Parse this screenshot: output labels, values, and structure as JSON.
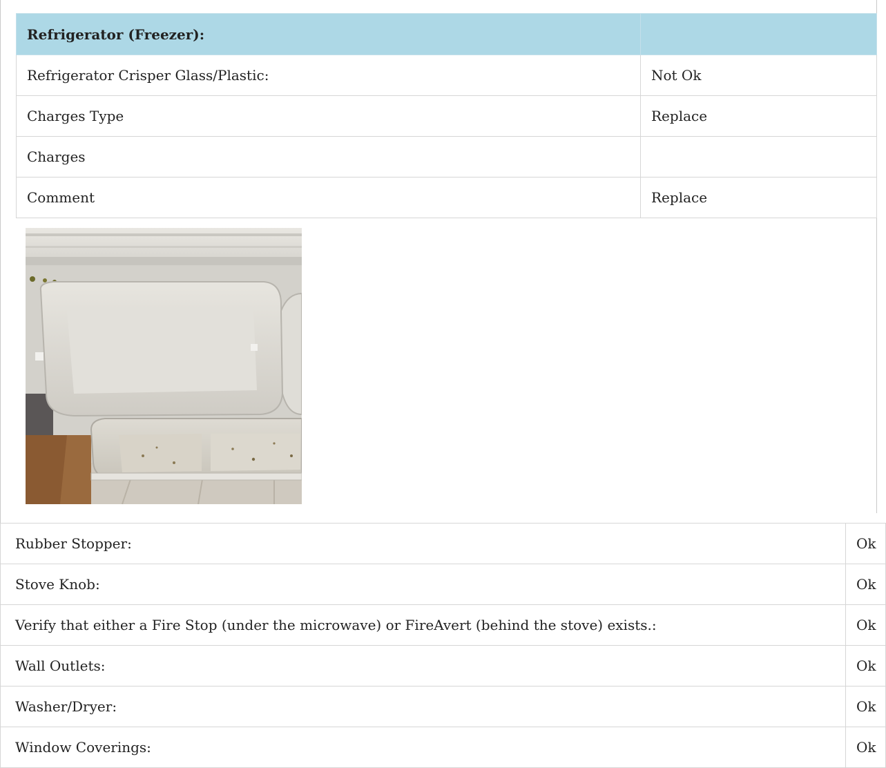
{
  "section": {
    "title": "Refrigerator (Freezer):",
    "rows": [
      {
        "label": "Refrigerator Crisper Glass/Plastic:",
        "value": "Not Ok"
      },
      {
        "label": "Charges Type",
        "value": "Replace"
      },
      {
        "label": "Charges",
        "value": ""
      },
      {
        "label": "Comment",
        "value": "Replace"
      }
    ],
    "photo": {
      "subject": "freezer-door-shelves-photo"
    }
  },
  "items": [
    {
      "label": "Rubber Stopper:",
      "value": "Ok"
    },
    {
      "label": "Stove Knob:",
      "value": "Ok"
    },
    {
      "label": "Verify that either a Fire Stop (under the microwave) or FireAvert (behind the stove) exists.:",
      "value": "Ok"
    },
    {
      "label": "Wall Outlets:",
      "value": "Ok"
    },
    {
      "label": "Washer/Dryer:",
      "value": "Ok"
    },
    {
      "label": "Window Coverings:",
      "value": "Ok"
    }
  ],
  "colors": {
    "header_bg": "#add8e6",
    "border": "#d6d6d6",
    "text": "#222222"
  }
}
